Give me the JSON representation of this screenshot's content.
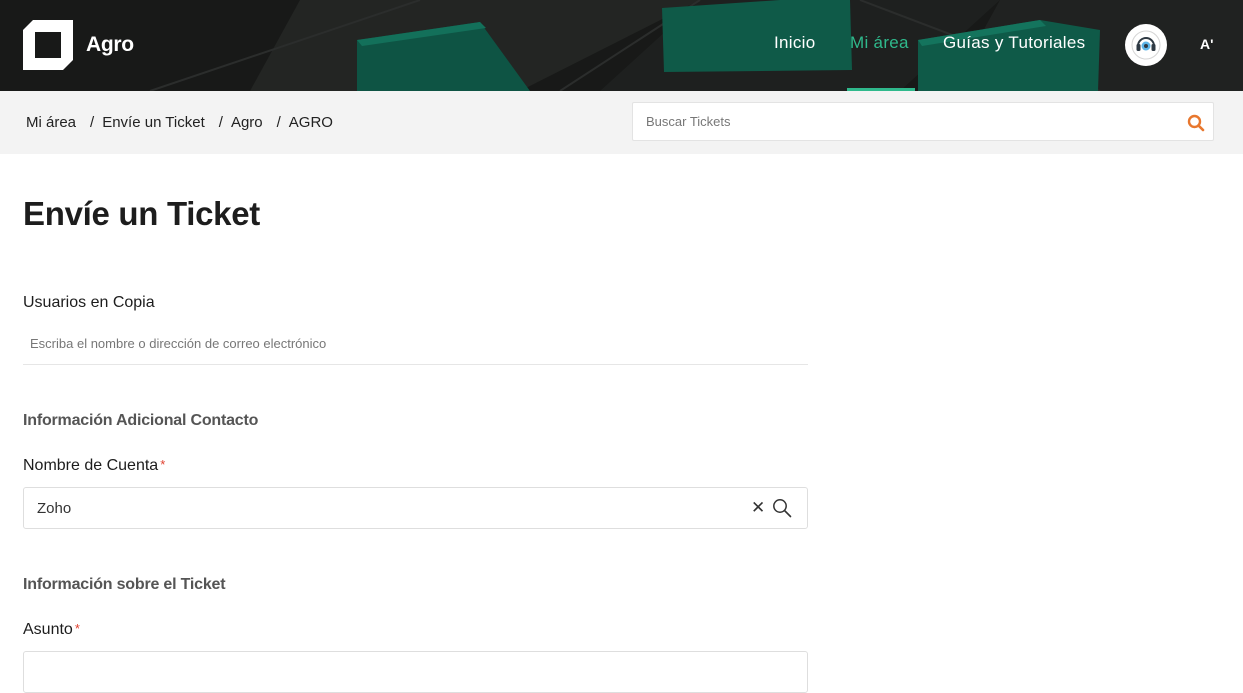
{
  "header": {
    "brand": "Agro",
    "nav": [
      {
        "label": "Inicio",
        "active": false
      },
      {
        "label": "Mi área",
        "active": true
      },
      {
        "label": "Guías y Tutoriales",
        "active": false
      }
    ],
    "font_toggle": "A'",
    "accent_color": "#2fb98c"
  },
  "breadcrumb": {
    "items": [
      "Mi área",
      "Envíe un Ticket",
      "Agro",
      "AGRO"
    ],
    "separator": "/"
  },
  "search": {
    "placeholder": "Buscar Tickets",
    "icon": "search-icon",
    "icon_color": "#e8772e"
  },
  "page": {
    "title": "Envíe un Ticket"
  },
  "form": {
    "cc": {
      "label": "Usuarios en Copia",
      "placeholder": "Escriba el nombre o dirección de correo electrónico"
    },
    "section_contact": "Información Adicional Contacto",
    "account": {
      "label": "Nombre de Cuenta",
      "required_mark": "*",
      "value": "Zoho",
      "clear_symbol": "✕"
    },
    "section_ticket": "Información sobre el Ticket",
    "subject": {
      "label": "Asunto",
      "required_mark": "*",
      "value": ""
    }
  }
}
